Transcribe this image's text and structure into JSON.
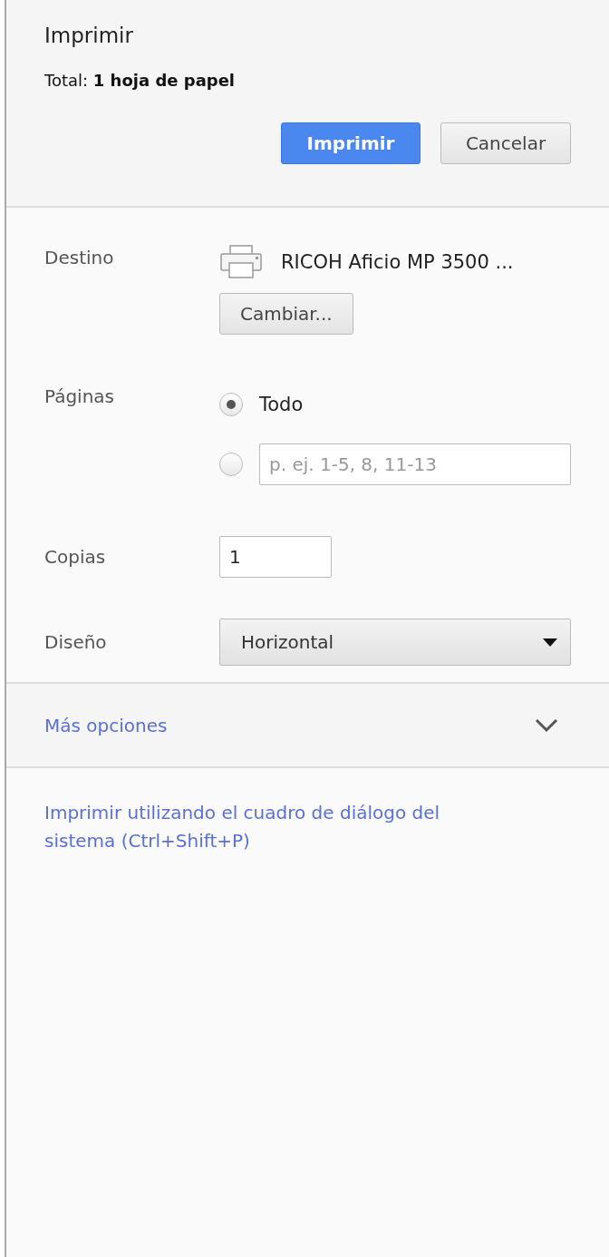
{
  "header": {
    "title": "Imprimir",
    "total": "Total: **1 hoja de papel**",
    "buttons": [
      {
        "label": "Imprimir",
        "kind": "primary"
      },
      {
        "label": "Cancelar",
        "kind": "secondary"
      }
    ]
  },
  "destination": {
    "label": "Destino",
    "printer": "RICOH Aficio MP 3500 ...",
    "change_button": "Cambiar..."
  },
  "pages": {
    "label": "Páginas",
    "options": [
      {
        "kind": "all",
        "label": "Todo",
        "selected": true
      },
      {
        "kind": "range",
        "placeholder": "p. ej. 1-5, 8, 11-13",
        "selected": false
      }
    ]
  },
  "copies": {
    "label": "Copias",
    "value": "1"
  },
  "layout": {
    "label": "Diseño",
    "value": "Horizontal"
  },
  "more_options": {
    "label": "Más opciones",
    "expanded": false
  },
  "system_dialog_link": "Imprimir utilizando el cuadro de diálogo del sistema (Ctrl+Shift+P)"
}
